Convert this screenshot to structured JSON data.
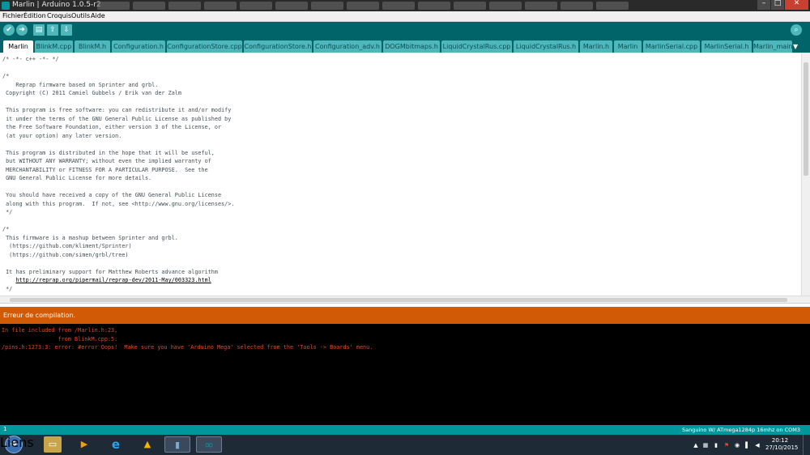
{
  "window": {
    "title": "Marlin | Arduino 1.0.5-r2",
    "controls": {
      "minimize": "–",
      "maximize": "□",
      "close": "✕"
    }
  },
  "menu": {
    "items": [
      "Fichier",
      "Édition",
      "Croquis",
      "Outils",
      "Aide"
    ]
  },
  "toolbar": {
    "verify_icon": "✔",
    "upload_icon": "➜",
    "new_icon": "▤",
    "open_icon": "⇧",
    "save_icon": "⇩",
    "serial_monitor_icon": "⌕"
  },
  "tabs": [
    "Marlin",
    "BlinkM.cpp",
    "BlinkM.h",
    "Configuration.h",
    "ConfigurationStore.cpp",
    "ConfigurationStore.h",
    "Configuration_adv.h",
    "DOGMbitmaps.h",
    "LiquidCrystalRus.cpp",
    "LiquidCrystalRus.h",
    "Marlin.h",
    "Marlin",
    "MarlinSerial.cpp",
    "MarlinSerial.h",
    "Marlin_main"
  ],
  "tab_overflow_icon": "▼",
  "editor": {
    "lines": [
      "/* -*- c++ -*- */",
      "",
      "/*",
      "    Reprap firmware based on Sprinter and grbl.",
      " Copyright (C) 2011 Camiel Gubbels / Erik van der Zalm",
      "",
      " This program is free software: you can redistribute it and/or modify",
      " it under the terms of the GNU General Public License as published by",
      " the Free Software Foundation, either version 3 of the License, or",
      " (at your option) any later version.",
      "",
      " This program is distributed in the hope that it will be useful,",
      " but WITHOUT ANY WARRANTY; without even the implied warranty of",
      " MERCHANTABILITY or FITNESS FOR A PARTICULAR PURPOSE.  See the",
      " GNU General Public License for more details.",
      "",
      " You should have received a copy of the GNU General Public License",
      " along with this program.  If not, see <http://www.gnu.org/licenses/>.",
      " */",
      "",
      "/*",
      " This firmware is a mashup between Sprinter and grbl.",
      "  (https://github.com/kliment/Sprinter)",
      "  (https://github.com/simen/grbl/tree)",
      "",
      " It has preliminary support for Matthew Roberts advance algorithm",
      "    http://reprap.org/pipermail/reprap-dev/2011-May/003323.html",
      " */"
    ],
    "link_line": "http://reprap.org/pipermail/reprap-dev/2011-May/003323.html"
  },
  "status_message": "Erreur de compilation.",
  "console": {
    "lines": [
      "In file included from /Marlin.h:23,",
      "                 from BlinkM.cpp:5:",
      "/pins.h:1273:3: error: #error Oops!  Make sure you have 'Arduino Mega' selected from the 'Tools -> Boards' menu."
    ]
  },
  "statusbar": {
    "line_number": "1",
    "board": "Sanguino W/ ATmega1284p 16mhz on COM3"
  },
  "taskbar": {
    "start_icon": "❖",
    "pinned_icons": [
      "explorer-icon",
      "media-player-icon",
      "internet-explorer-icon",
      "google-drive-icon",
      "phone-icon",
      "arduino-icon"
    ],
    "pinned_glyphs": [
      "▭",
      "▶",
      "e",
      "▲",
      "▮",
      "∞"
    ],
    "links_label": "Liens",
    "tray_glyphs": [
      "▲",
      "▦",
      "▮",
      "⚑",
      "◉",
      "▌",
      "◀"
    ],
    "clock_time": "20:12",
    "clock_date": "27/10/2015"
  },
  "colors": {
    "toolbar": "#006468",
    "tab": "#4db7bb",
    "status": "#00979c",
    "error_bar": "#d05a06",
    "console_text": "#e34c22"
  }
}
